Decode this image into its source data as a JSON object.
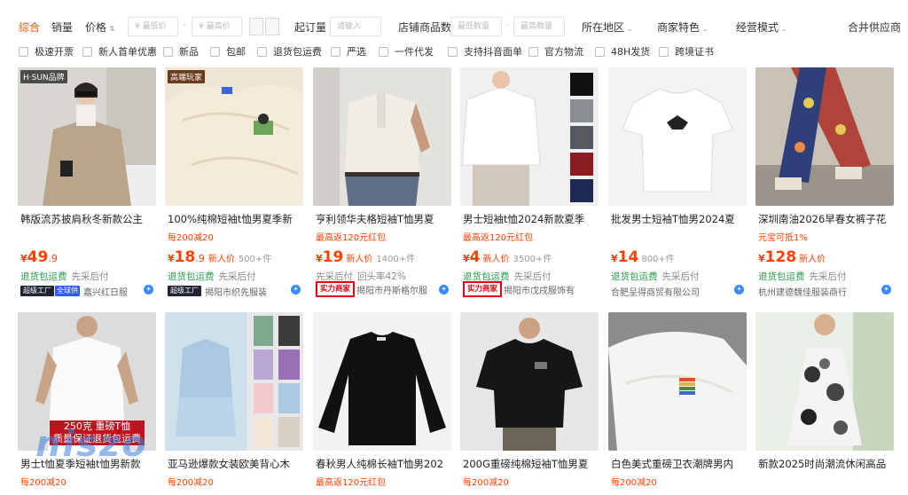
{
  "filters": {
    "sort_comprehensive": "综合",
    "sort_sales": "销量",
    "sort_price": "价格",
    "price_min_placeholder": "¥ 最低价",
    "price_max_placeholder": "¥ 最高价",
    "moq_label": "起订量",
    "moq_placeholder": "请输入",
    "shop_count_label": "店铺商品数",
    "count_min_placeholder": "最低数量",
    "count_max_placeholder": "最高数量",
    "region_label": "所在地区",
    "merchant_feature_label": "商家特色",
    "business_mode_label": "经营模式",
    "merge_suppliers": "合并供应商",
    "checkboxes": [
      "极速开票",
      "新人首单优惠",
      "新品",
      "包邮",
      "退货包运费",
      "严选",
      "一件代发",
      "支持抖音面单",
      "官方物流",
      "48H发货",
      "跨境证书"
    ]
  },
  "products": [
    {
      "title": "韩版流苏披肩秋冬新款公主",
      "promo": "",
      "price": "49",
      "price_dec": ".9",
      "new_tag": "",
      "sold": "",
      "service1": "退货包运费",
      "service2": "先采后付",
      "badge1": "超级工厂",
      "badge2": "全球供",
      "badge_red": "",
      "shop": "嘉兴红日服",
      "overlay": "H·SUN品牌"
    },
    {
      "title": "100%纯棉短袖t恤男夏季新",
      "promo": "每200减20",
      "price": "18",
      "price_dec": ".9",
      "new_tag": "新人价",
      "sold": "500+件",
      "service1": "退货包运费",
      "service2": "先采后付",
      "badge1": "超级工厂",
      "badge2": "",
      "badge_red": "",
      "shop": "揭阳市织先服装",
      "overlay": "高端玩家"
    },
    {
      "title": "亨利领华夫格短袖T恤男夏",
      "promo": "最高返120元红包",
      "price": "19",
      "price_dec": "",
      "new_tag": "新人价",
      "sold": "1400+件",
      "service1": "先采后付",
      "service2": "回头率42%",
      "badge1": "",
      "badge2": "",
      "badge_red": "实力商家",
      "shop": "揭阳市丹斯格尔服",
      "overlay": ""
    },
    {
      "title": "男士短袖t恤2024新款夏季",
      "promo": "最高返120元红包",
      "price": "4",
      "price_dec": "",
      "new_tag": "新人价",
      "sold": "3500+件",
      "service1": "退货包运费",
      "service2": "先采后付",
      "badge1": "",
      "badge2": "",
      "badge_red": "实力商家",
      "shop": "揭阳市戊戌服饰有",
      "overlay": ""
    },
    {
      "title": "批发男士短袖T恤男2024夏",
      "promo": "",
      "price": "14",
      "price_dec": "",
      "new_tag": "",
      "sold": "800+件",
      "service1": "退货包运费",
      "service2": "先采后付",
      "badge1": "",
      "badge2": "",
      "badge_red": "",
      "shop": "合肥呈得商贸有限公司",
      "overlay": ""
    },
    {
      "title": "深圳南油2026早春女裤子花",
      "promo": "元宝可抵1%",
      "price": "128",
      "price_dec": "",
      "new_tag": "新人价",
      "sold": "",
      "service1": "退货包运费",
      "service2": "先采后付",
      "badge1": "",
      "badge2": "",
      "badge_red": "",
      "shop": "杭州建德魏佳服装商行",
      "overlay": ""
    },
    {
      "title": "男士t恤夏季短袖t恤男新款",
      "promo": "每200减20",
      "overlay_lines": [
        "250克 重磅T恤",
        "质量保证退货包运费"
      ]
    },
    {
      "title": "亚马逊爆款女装欧美背心木",
      "promo": "每200减20"
    },
    {
      "title": "春秋男人纯棉长袖T恤男202",
      "promo": "最高返120元红包"
    },
    {
      "title": "200G重磅纯棉短袖T恤男夏",
      "promo": "每200减20"
    },
    {
      "title": "白色美式重磅卫衣潮牌男内",
      "promo": "每200减20"
    },
    {
      "title": "新款2025时尚潮流休闲高品",
      "promo": ""
    }
  ],
  "watermark": "niszo",
  "colors": {
    "accent": "#ff5000",
    "price": "#ff4000",
    "service_green": "#2a9c4c",
    "badge_red": "#e60012"
  }
}
